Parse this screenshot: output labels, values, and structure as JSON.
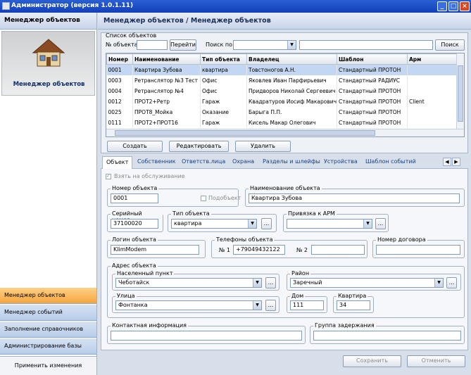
{
  "window": {
    "title": "Администратор (версия 1.0.1.11)"
  },
  "sidebar": {
    "header": "Менеджер объектов",
    "card_label": "Менеджер объектов",
    "items": [
      {
        "label": "Менеджер объектов",
        "active": true
      },
      {
        "label": "Менеджер событий",
        "active": false
      },
      {
        "label": "Заполнение справочников",
        "active": false
      },
      {
        "label": "Администрирование базы",
        "active": false
      }
    ],
    "apply_label": "Применить изменения"
  },
  "main": {
    "title": "Менеджер объектов / Менеджер объектов"
  },
  "object_list": {
    "group_title": "Список объектов",
    "object_no_label": "№ объекта",
    "object_no_value": "",
    "goto_label": "Перейти",
    "search_by_label": "Поиск по",
    "search_by_value": "",
    "search_value": "",
    "search_label": "Поиск",
    "columns": [
      "Номер",
      "Наименование",
      "Тип объекта",
      "Владелец",
      "Шаблон",
      "Арм"
    ],
    "rows": [
      [
        "0001",
        "Квартира Зубова",
        "квартира",
        "Товстоногов А.Н.",
        "Стандартный ПРОТОН",
        ""
      ],
      [
        "0003",
        "Ретранслятор №3 Тест",
        "Офис",
        "Яковлев Иван Парфирьевич",
        "Стандартный РАДИУС",
        ""
      ],
      [
        "0004",
        "Ретранслятор №4",
        "Офис",
        "Придворов Николай Сергеевич",
        "Стандартный ПРОТОН",
        ""
      ],
      [
        "0012",
        "ПРОТ2+Ретр",
        "Гараж",
        "Квадратуров Иосиф Макарович",
        "Стандартный ПРОТОН",
        "Client"
      ],
      [
        "0025",
        "ПРОТ8_Мойка",
        "Оказание",
        "Барыга П.П.",
        "Стандартный ПРОТОН",
        ""
      ],
      [
        "0111",
        "ПРОТ2+ПРОТ16",
        "Гараж",
        "Кисель Макар Олегович",
        "Стандартный ПРОТОН",
        ""
      ]
    ],
    "selected_row": 0,
    "create_label": "Создать",
    "edit_label": "Редактировать",
    "delete_label": "Удалить"
  },
  "tabs": [
    "Объект",
    "Собственник",
    "Ответств.лица",
    "Охрана",
    "Разделы и шлейфы",
    "Устройства",
    "Шаблон событий"
  ],
  "form": {
    "take_service_label": "Взять на обслуживание",
    "take_service_checked": true,
    "object_number_label": "Номер объекта",
    "object_number_value": "0001",
    "subobject_label": "Подобъект",
    "object_name_label": "Наименование объекта",
    "object_name_value": "Квартира Зубова",
    "serial_label": "Серийный номер",
    "serial_value": "37100020",
    "type_label": "Тип объекта",
    "type_value": "квартира",
    "arm_label": "Привязка к АРМ",
    "arm_value": "",
    "login_label": "Логин объекта",
    "login_value": "KlimModem",
    "phones_label": "Телефоны объекта",
    "phone1_label": "№ 1",
    "phone1_value": "+79049432122",
    "phone2_label": "№ 2",
    "phone2_value": "",
    "contract_label": "Номер договора",
    "contract_value": "",
    "address_label": "Адрес объекта",
    "locality_label": "Населенный пункт",
    "locality_value": "Чеботайск",
    "district_label": "Район",
    "district_value": "Заречный",
    "street_label": "Улица",
    "street_value": "Фонтанка",
    "house_label": "Дом",
    "house_value": "111",
    "flat_label": "Квартира",
    "flat_value": "34",
    "contact_label": "Контактная информация",
    "contact_value": "",
    "delay_label": "Группа задержания",
    "delay_value": "",
    "save_label": "Сохранить",
    "cancel_label": "Отменить",
    "ellipsis": "..."
  }
}
